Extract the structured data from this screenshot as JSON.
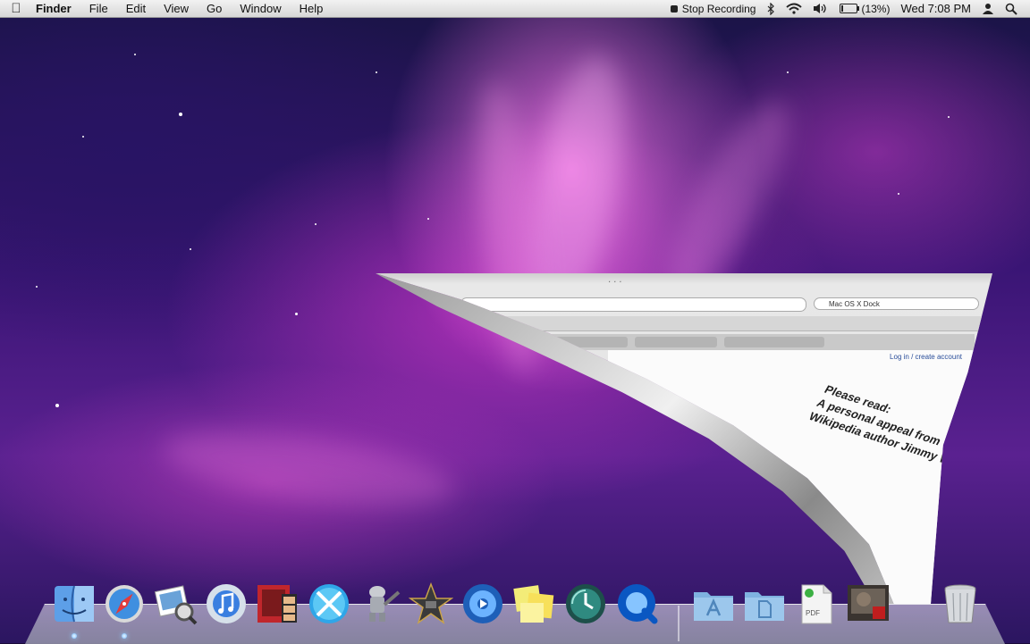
{
  "menubar": {
    "apple_icon": "apple-icon",
    "app_name": "Finder",
    "menus": [
      "File",
      "Edit",
      "View",
      "Go",
      "Window",
      "Help"
    ],
    "status": {
      "recording_label": "Stop Recording",
      "bluetooth_icon": "bluetooth-icon",
      "wifi_icon": "wifi-icon",
      "volume_icon": "volume-icon",
      "battery_percent": "(13%)",
      "battery_level": 0.13,
      "clock": "Wed 7:08 PM",
      "user_icon": "user-icon",
      "spotlight_icon": "spotlight-icon"
    }
  },
  "curled_window": {
    "search_text": "Mac OS X Dock",
    "login_text": "Log in / create account",
    "note_lines": "Please read:\nA personal appeal from\nWikipedia author Jimmy Wales"
  },
  "dock": {
    "apps": [
      {
        "name": "finder",
        "icon": "finder-icon"
      },
      {
        "name": "safari",
        "icon": "safari-icon"
      },
      {
        "name": "preview",
        "icon": "preview-icon"
      },
      {
        "name": "itunes",
        "icon": "itunes-icon"
      },
      {
        "name": "photo-booth",
        "icon": "photo-booth-icon"
      },
      {
        "name": "x11",
        "icon": "x11-icon"
      },
      {
        "name": "automator",
        "icon": "automator-icon"
      },
      {
        "name": "imovie",
        "icon": "imovie-icon"
      },
      {
        "name": "dvd-player",
        "icon": "dvd-player-icon"
      },
      {
        "name": "stickies",
        "icon": "stickies-icon"
      },
      {
        "name": "time-machine",
        "icon": "time-machine-icon"
      },
      {
        "name": "quicktime",
        "icon": "quicktime-icon"
      }
    ],
    "stacks": [
      {
        "name": "applications-folder",
        "icon": "applications-folder-icon"
      },
      {
        "name": "documents-folder",
        "icon": "documents-folder-icon"
      },
      {
        "name": "pdf-document",
        "icon": "pdf-document-icon"
      },
      {
        "name": "video-thumbnail",
        "icon": "video-thumbnail-icon"
      },
      {
        "name": "trash",
        "icon": "trash-icon"
      }
    ],
    "accent_color": "#6fb8ff"
  }
}
